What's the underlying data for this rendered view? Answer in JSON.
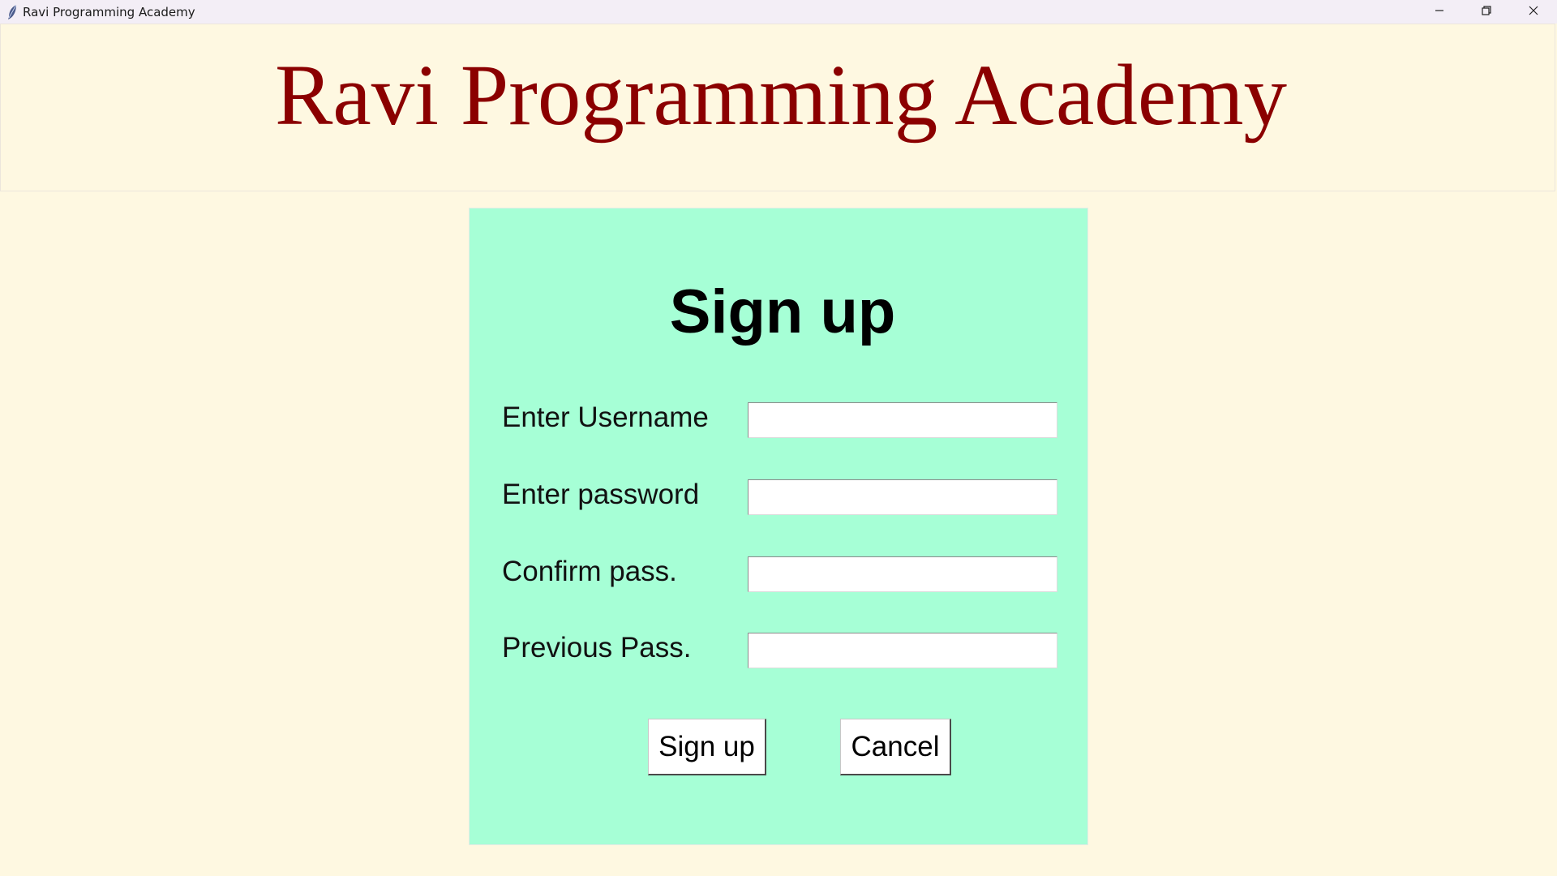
{
  "window": {
    "title": "Ravi Programming Academy",
    "icon": "feather-icon",
    "controls": [
      "minimize-icon",
      "restore-icon",
      "close-icon"
    ]
  },
  "header": {
    "title": "Ravi Programming Academy"
  },
  "form": {
    "heading": "Sign up",
    "fields": [
      {
        "label": "Enter Username",
        "value": ""
      },
      {
        "label": "Enter password",
        "value": ""
      },
      {
        "label": "Confirm pass.",
        "value": ""
      },
      {
        "label": "Previous Pass.",
        "value": ""
      }
    ],
    "signup_label": "Sign up",
    "cancel_label": "Cancel"
  },
  "colors": {
    "background": "#fef8e1",
    "title": "#8b0000",
    "card": "#a6ffd6"
  }
}
